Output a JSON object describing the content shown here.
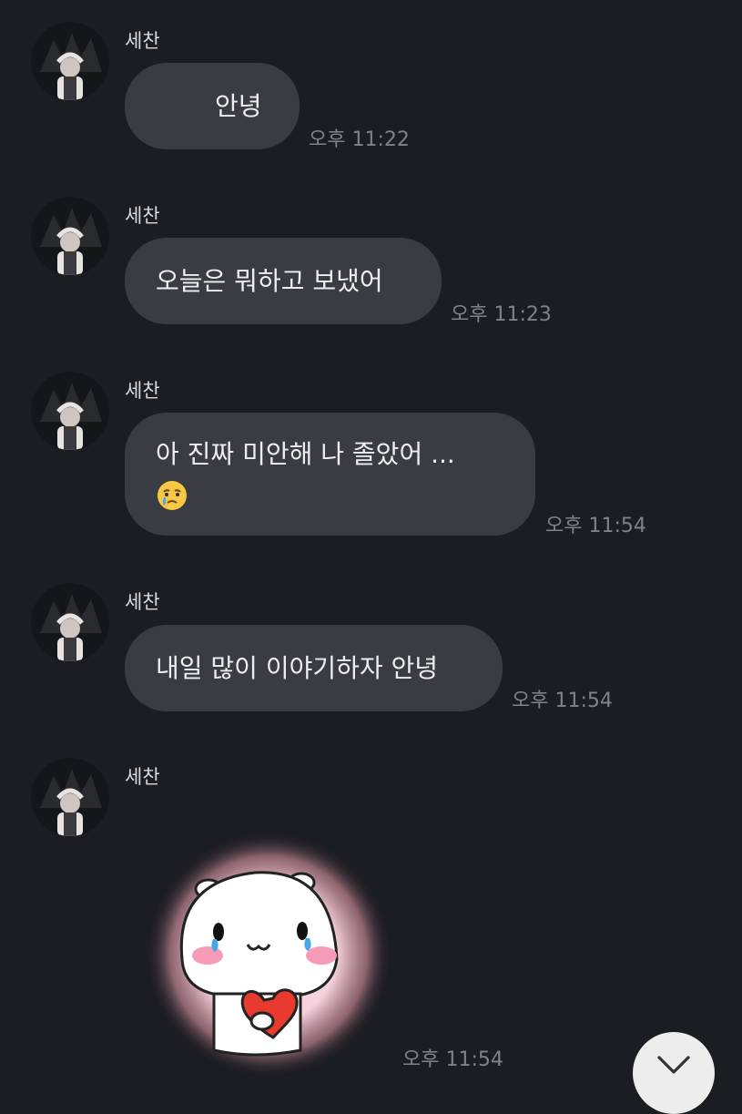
{
  "messages": [
    {
      "sender": "세찬",
      "text": "안녕",
      "time": "오후 11:22"
    },
    {
      "sender": "세찬",
      "text": "오늘은 뭐하고 보냈어",
      "time": "오후 11:23"
    },
    {
      "sender": "세찬",
      "text": "아 진짜 미안해 나 졸았어 ...",
      "emoji": "crying-face",
      "time": "오후 11:54"
    },
    {
      "sender": "세찬",
      "text": "내일 많이 이야기하자 안녕",
      "time": "오후 11:54"
    },
    {
      "sender": "세찬",
      "sticker": "crying-hamster-heart-sticker",
      "time": "오후 11:54"
    }
  ],
  "colors": {
    "background": "#1c1d22",
    "bubble": "#3a3c43",
    "text": "#eceef2",
    "timestamp": "#7f8289"
  },
  "icons": {
    "scroll_down": "chevron-down-icon"
  }
}
